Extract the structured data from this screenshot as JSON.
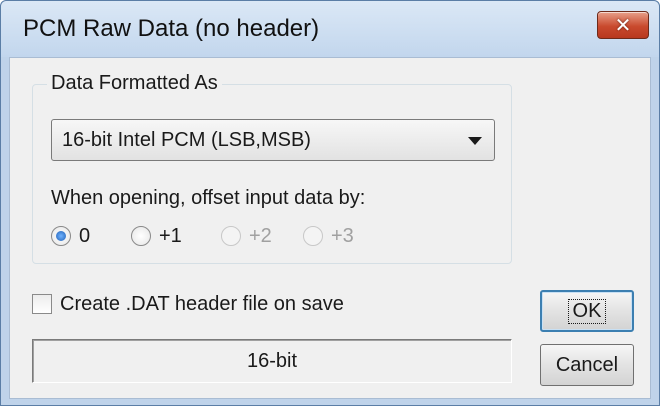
{
  "window": {
    "title": "PCM Raw Data (no header)",
    "close_glyph": "✕"
  },
  "format_group": {
    "title": "Data Formatted As",
    "combo_value": "16-bit Intel PCM (LSB,MSB)",
    "offset_label": "When opening, offset input data by:",
    "offset_options": [
      {
        "label": "0",
        "checked": true,
        "enabled": true
      },
      {
        "label": "+1",
        "checked": false,
        "enabled": true
      },
      {
        "label": "+2",
        "checked": false,
        "enabled": false
      },
      {
        "label": "+3",
        "checked": false,
        "enabled": false
      }
    ]
  },
  "create_dat": {
    "label": "Create .DAT header file on save",
    "checked": false
  },
  "status_text": "16-bit",
  "buttons": {
    "ok": "OK",
    "cancel": "Cancel"
  },
  "colors": {
    "accent_focus": "#3c7fb1",
    "close_button": "#c94a2e"
  }
}
